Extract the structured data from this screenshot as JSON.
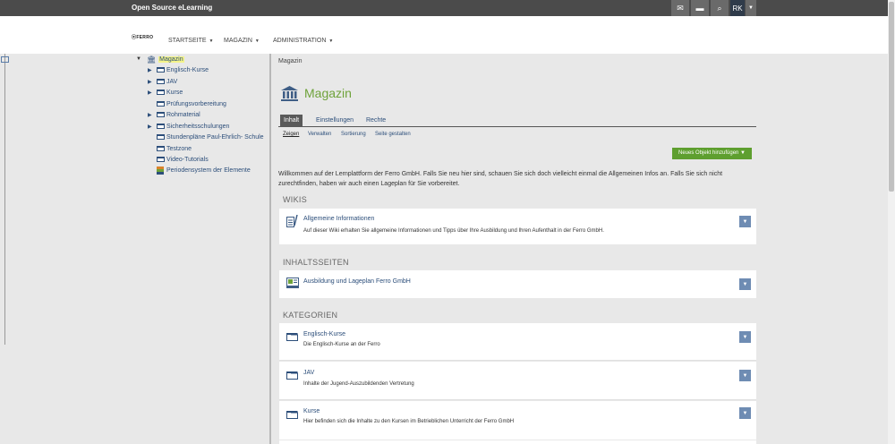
{
  "topbar": {
    "brand": "Open Source eLearning",
    "icons": [
      "mail-icon",
      "chat-icon",
      "search-icon"
    ],
    "user_initials": "RK"
  },
  "header": {
    "logo_text": "FERRO",
    "nav": [
      {
        "label": "STARTSEITE"
      },
      {
        "label": "MAGAZIN"
      },
      {
        "label": "ADMINISTRATION"
      }
    ]
  },
  "tree": {
    "root": "Magazin",
    "items": [
      {
        "label": "Englisch-Kurse",
        "expandable": true
      },
      {
        "label": "JAV",
        "expandable": true
      },
      {
        "label": "Kurse",
        "expandable": true
      },
      {
        "label": "Prüfungsvorbereitung",
        "expandable": false
      },
      {
        "label": "Rohmaterial",
        "expandable": true
      },
      {
        "label": "Sicherheitsschulungen",
        "expandable": true
      },
      {
        "label": "Stundenpläne Paul-Ehrlich- Schule",
        "expandable": false
      },
      {
        "label": "Testzone",
        "expandable": false
      },
      {
        "label": "Video-Tutorials",
        "expandable": false
      },
      {
        "label": "Periodensystem der Elemente",
        "expandable": false
      }
    ]
  },
  "content": {
    "breadcrumb": "Magazin",
    "title": "Magazin",
    "tabs": [
      {
        "label": "Inhalt",
        "active": true
      },
      {
        "label": "Einstellungen",
        "active": false
      },
      {
        "label": "Rechte",
        "active": false
      }
    ],
    "subtabs": [
      {
        "label": "Zeigen",
        "active": true
      },
      {
        "label": "Verwalten",
        "active": false
      },
      {
        "label": "Sortierung",
        "active": false
      },
      {
        "label": "Seite gestalten",
        "active": false
      }
    ],
    "new_button": "Neues Objekt hinzufügen",
    "welcome": "Willkommen auf der Lernplattform der Ferro GmbH. Falls Sie neu hier sind, schauen Sie sich doch vielleicht einmal die Allgemeinen Infos an. Falls Sie sich nicht zurechtfinden, haben wir auch einen Lageplan für Sie vorbereitet.",
    "sections": {
      "wikis": {
        "heading": "WIKIS",
        "items": [
          {
            "title": "Allgemeine Informationen",
            "desc": "Auf dieser Wiki erhalten Sie allgemeine Informationen und Tipps über Ihre Ausbildung und Ihren Aufenthalt in der Ferro GmbH."
          }
        ]
      },
      "inhaltsseiten": {
        "heading": "INHALTSSEITEN",
        "items": [
          {
            "title": "Ausbildung und Lageplan Ferro GmbH",
            "desc": ""
          }
        ]
      },
      "kategorien": {
        "heading": "KATEGORIEN",
        "items": [
          {
            "title": "Englisch-Kurse",
            "desc": "Die Englisch-Kurse an der Ferro"
          },
          {
            "title": "JAV",
            "desc": "Inhalte der Jugend-Auszubildenden Vertretung"
          },
          {
            "title": "Kurse",
            "desc": "Hier befinden sich die Inhalte zu den Kursen im Betrieblichen Unterricht der Ferro GmbH"
          }
        ]
      }
    }
  },
  "colors": {
    "topbar": "#4b4b4b",
    "accent_green": "#6ea23a",
    "button_green": "#5e9f2f",
    "link_blue": "#2c4e7a",
    "dropdown_blue": "#6e8cb3"
  }
}
